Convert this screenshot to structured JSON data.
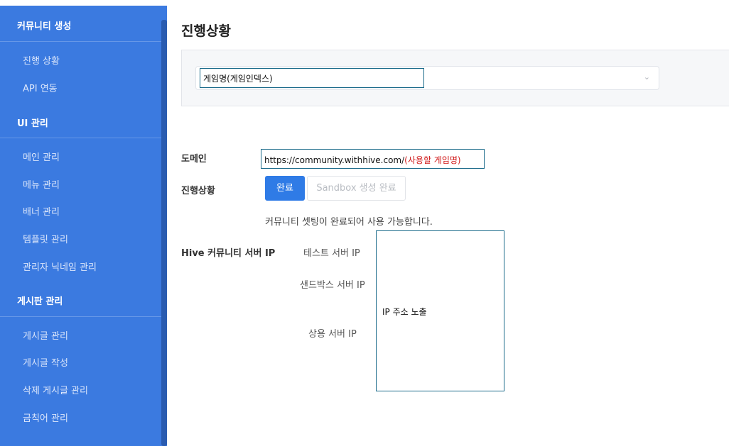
{
  "sidebar": {
    "sections": [
      {
        "title": "커뮤니티 생성",
        "items": [
          "진행 상황",
          "API 연동"
        ]
      },
      {
        "title": "UI 관리",
        "items": [
          "메인 관리",
          "메뉴 관리",
          "배너 관리",
          "템플릿 관리",
          "관리자 닉네임 관리"
        ]
      },
      {
        "title": "게시판 관리",
        "items": [
          "게시글 관리",
          "게시글 작성",
          "삭제 게시글 관리",
          "금칙어 관리"
        ]
      }
    ]
  },
  "main": {
    "title": "진행상황",
    "game_select": {
      "value": "게임명(게임인덱스)",
      "chevron": "⌄"
    },
    "domain": {
      "label": "도메인",
      "prefix": "https://community.withhive.com/",
      "suffix": "(사용할 게임명)"
    },
    "progress": {
      "label": "진행상황",
      "done_button": "완료",
      "sandbox_button": "Sandbox 생성 완료",
      "message": "커뮤니티 셋팅이 완료되어 사용 가능합니다."
    },
    "hive_ip": {
      "label": "Hive 커뮤니티 서버 IP",
      "test": "테스트 서버 IP",
      "sandbox": "샌드박스 서버 IP",
      "live": "상용 서버 IP",
      "box_text": "IP 주소 노출"
    }
  },
  "colors": {
    "sidebar_bg": "#3b7ae0",
    "accent": "#2f7be6",
    "highlight_red": "#d01818"
  }
}
